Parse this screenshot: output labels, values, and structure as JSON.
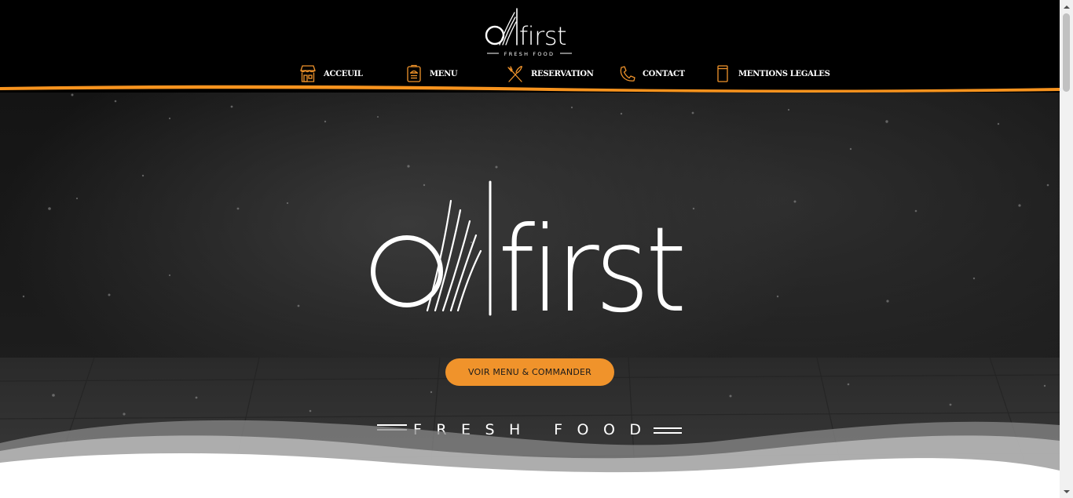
{
  "brand": {
    "name": "O'First",
    "logo_word": "first",
    "tagline": "FRESH FOOD",
    "accent_color": "#f0932b",
    "header_background": "#000000"
  },
  "nav": {
    "items": [
      {
        "label": "ACCEUIL",
        "icon": "storefront-icon"
      },
      {
        "label": "MENU",
        "icon": "menu-card-icon"
      },
      {
        "label": "RESERVATION",
        "icon": "fork-knife-icon"
      },
      {
        "label": "CONTACT",
        "icon": "phone-icon"
      },
      {
        "label": "MENTIONS LEGALES",
        "icon": "document-icon"
      }
    ]
  },
  "hero": {
    "cta_label": "VOIR MENU & COMMANDER",
    "cta_color": "#f0932b"
  }
}
